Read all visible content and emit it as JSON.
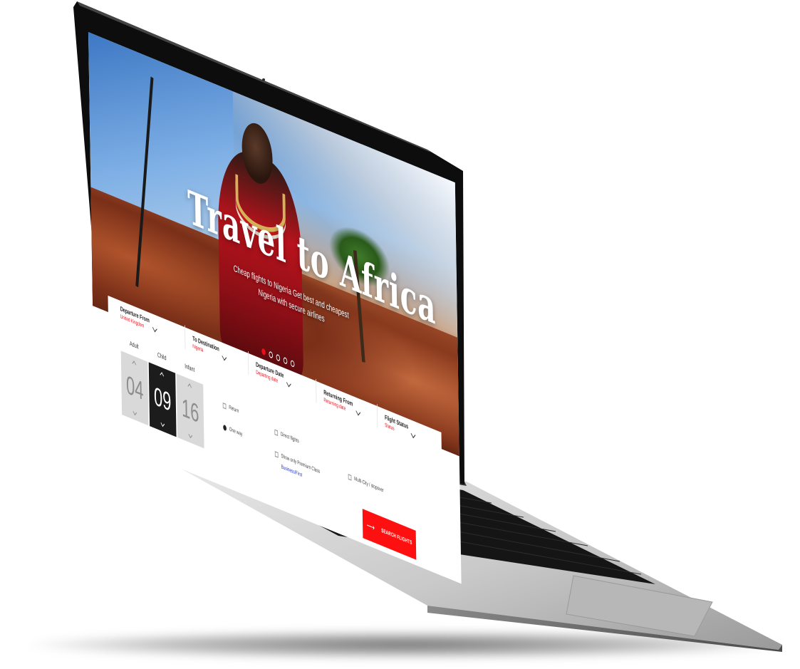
{
  "hero": {
    "title": "Travel to Africa",
    "subtitle": "Cheap flights to Nigeria Get best and cheapest Nigeria with secure airlines",
    "slides": [
      true,
      false,
      false,
      false,
      false
    ]
  },
  "form": {
    "departure_from": {
      "label": "Departure From",
      "value": "United Kingdom"
    },
    "to_destination": {
      "label": "To Destination",
      "value": "Nigeria"
    },
    "departure_date": {
      "label": "Departure Date",
      "value": "Departing date"
    },
    "returning_from": {
      "label": "Returning From",
      "value": "Returning date"
    },
    "flight_status": {
      "label": "Flight Status",
      "value": "Status"
    },
    "passengers": {
      "adult": {
        "label": "Adult",
        "value": "04"
      },
      "child": {
        "label": "Child",
        "value": "09"
      },
      "infant": {
        "label": "Infant",
        "value": "16"
      }
    },
    "options": {
      "return_label": "Return",
      "one_way_label": "One way",
      "direct_flights_label": "Direct flights",
      "premium_class_label": "Show only Premium Class",
      "premium_class_link": "Business/First",
      "multi_city_label": "Multi-City / stopover"
    },
    "search_label": "SEARCH FLIGHTS",
    "search_arrow": "⟶"
  },
  "colors": {
    "accent": "#ff1010",
    "text_dark": "#222222",
    "link": "#2338c9"
  }
}
